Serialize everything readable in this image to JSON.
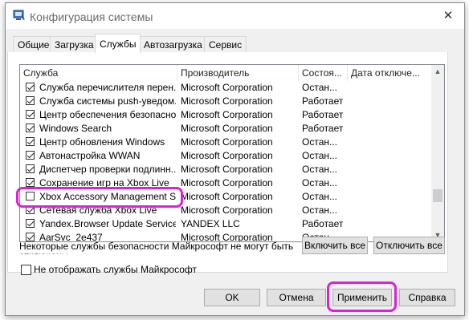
{
  "window": {
    "title": "Конфигурация системы"
  },
  "tabs": [
    {
      "label": "Общие"
    },
    {
      "label": "Загрузка"
    },
    {
      "label": "Службы"
    },
    {
      "label": "Автозагрузка"
    },
    {
      "label": "Сервис"
    }
  ],
  "active_tab": "Службы",
  "columns": {
    "service": "Служба",
    "manufacturer": "Производитель",
    "status": "Состоя...",
    "disabled_date": "Дата отключе..."
  },
  "services": [
    {
      "name": "Служба перечислителя перен...",
      "manufacturer": "Microsoft Corporation",
      "status": "Остан...",
      "checked": true
    },
    {
      "name": "Служба системы push-уведом...",
      "manufacturer": "Microsoft Corporation",
      "status": "Работает",
      "checked": true
    },
    {
      "name": "Центр обеспечения безопасно...",
      "manufacturer": "Microsoft Corporation",
      "status": "Работает",
      "checked": true
    },
    {
      "name": "Windows Search",
      "manufacturer": "Microsoft Corporation",
      "status": "Работает",
      "checked": true
    },
    {
      "name": "Центр обновления Windows",
      "manufacturer": "Microsoft Corporation",
      "status": "Остан...",
      "checked": true
    },
    {
      "name": "Автонастройка WWAN",
      "manufacturer": "Microsoft Corporation",
      "status": "Остан...",
      "checked": true
    },
    {
      "name": "Диспетчер проверки подлинн...",
      "manufacturer": "Microsoft Corporation",
      "status": "Остан...",
      "checked": true
    },
    {
      "name": "Сохранение игр на Xbox Live",
      "manufacturer": "Microsoft Corporation",
      "status": "Остан...",
      "checked": true
    },
    {
      "name": "Xbox Accessory Management Se...",
      "manufacturer": "Microsoft Corporation",
      "status": "Остан...",
      "checked": false
    },
    {
      "name": "Сетевая служба Xbox Live",
      "manufacturer": "Microsoft Corporation",
      "status": "Остан...",
      "checked": true
    },
    {
      "name": "Yandex.Browser Update Service",
      "manufacturer": "YANDEX LLC",
      "status": "Работает",
      "checked": true
    },
    {
      "name": "AarSvc_2e437",
      "manufacturer": "Microsoft Corporation",
      "status": "Остан...",
      "checked": true
    }
  ],
  "note": "Некоторые службы безопасности Майкрософт не могут быть отключены.",
  "buttons": {
    "enable_all": "Включить все",
    "disable_all": "Отключить все",
    "ok": "OK",
    "cancel": "Отмена",
    "apply": "Применить",
    "help": "Справка"
  },
  "hide_ms_label": "Не отображать службы Майкрософт",
  "hide_ms_checked": false,
  "colors": {
    "highlight": "#e020d8",
    "list_border": "#828790"
  }
}
